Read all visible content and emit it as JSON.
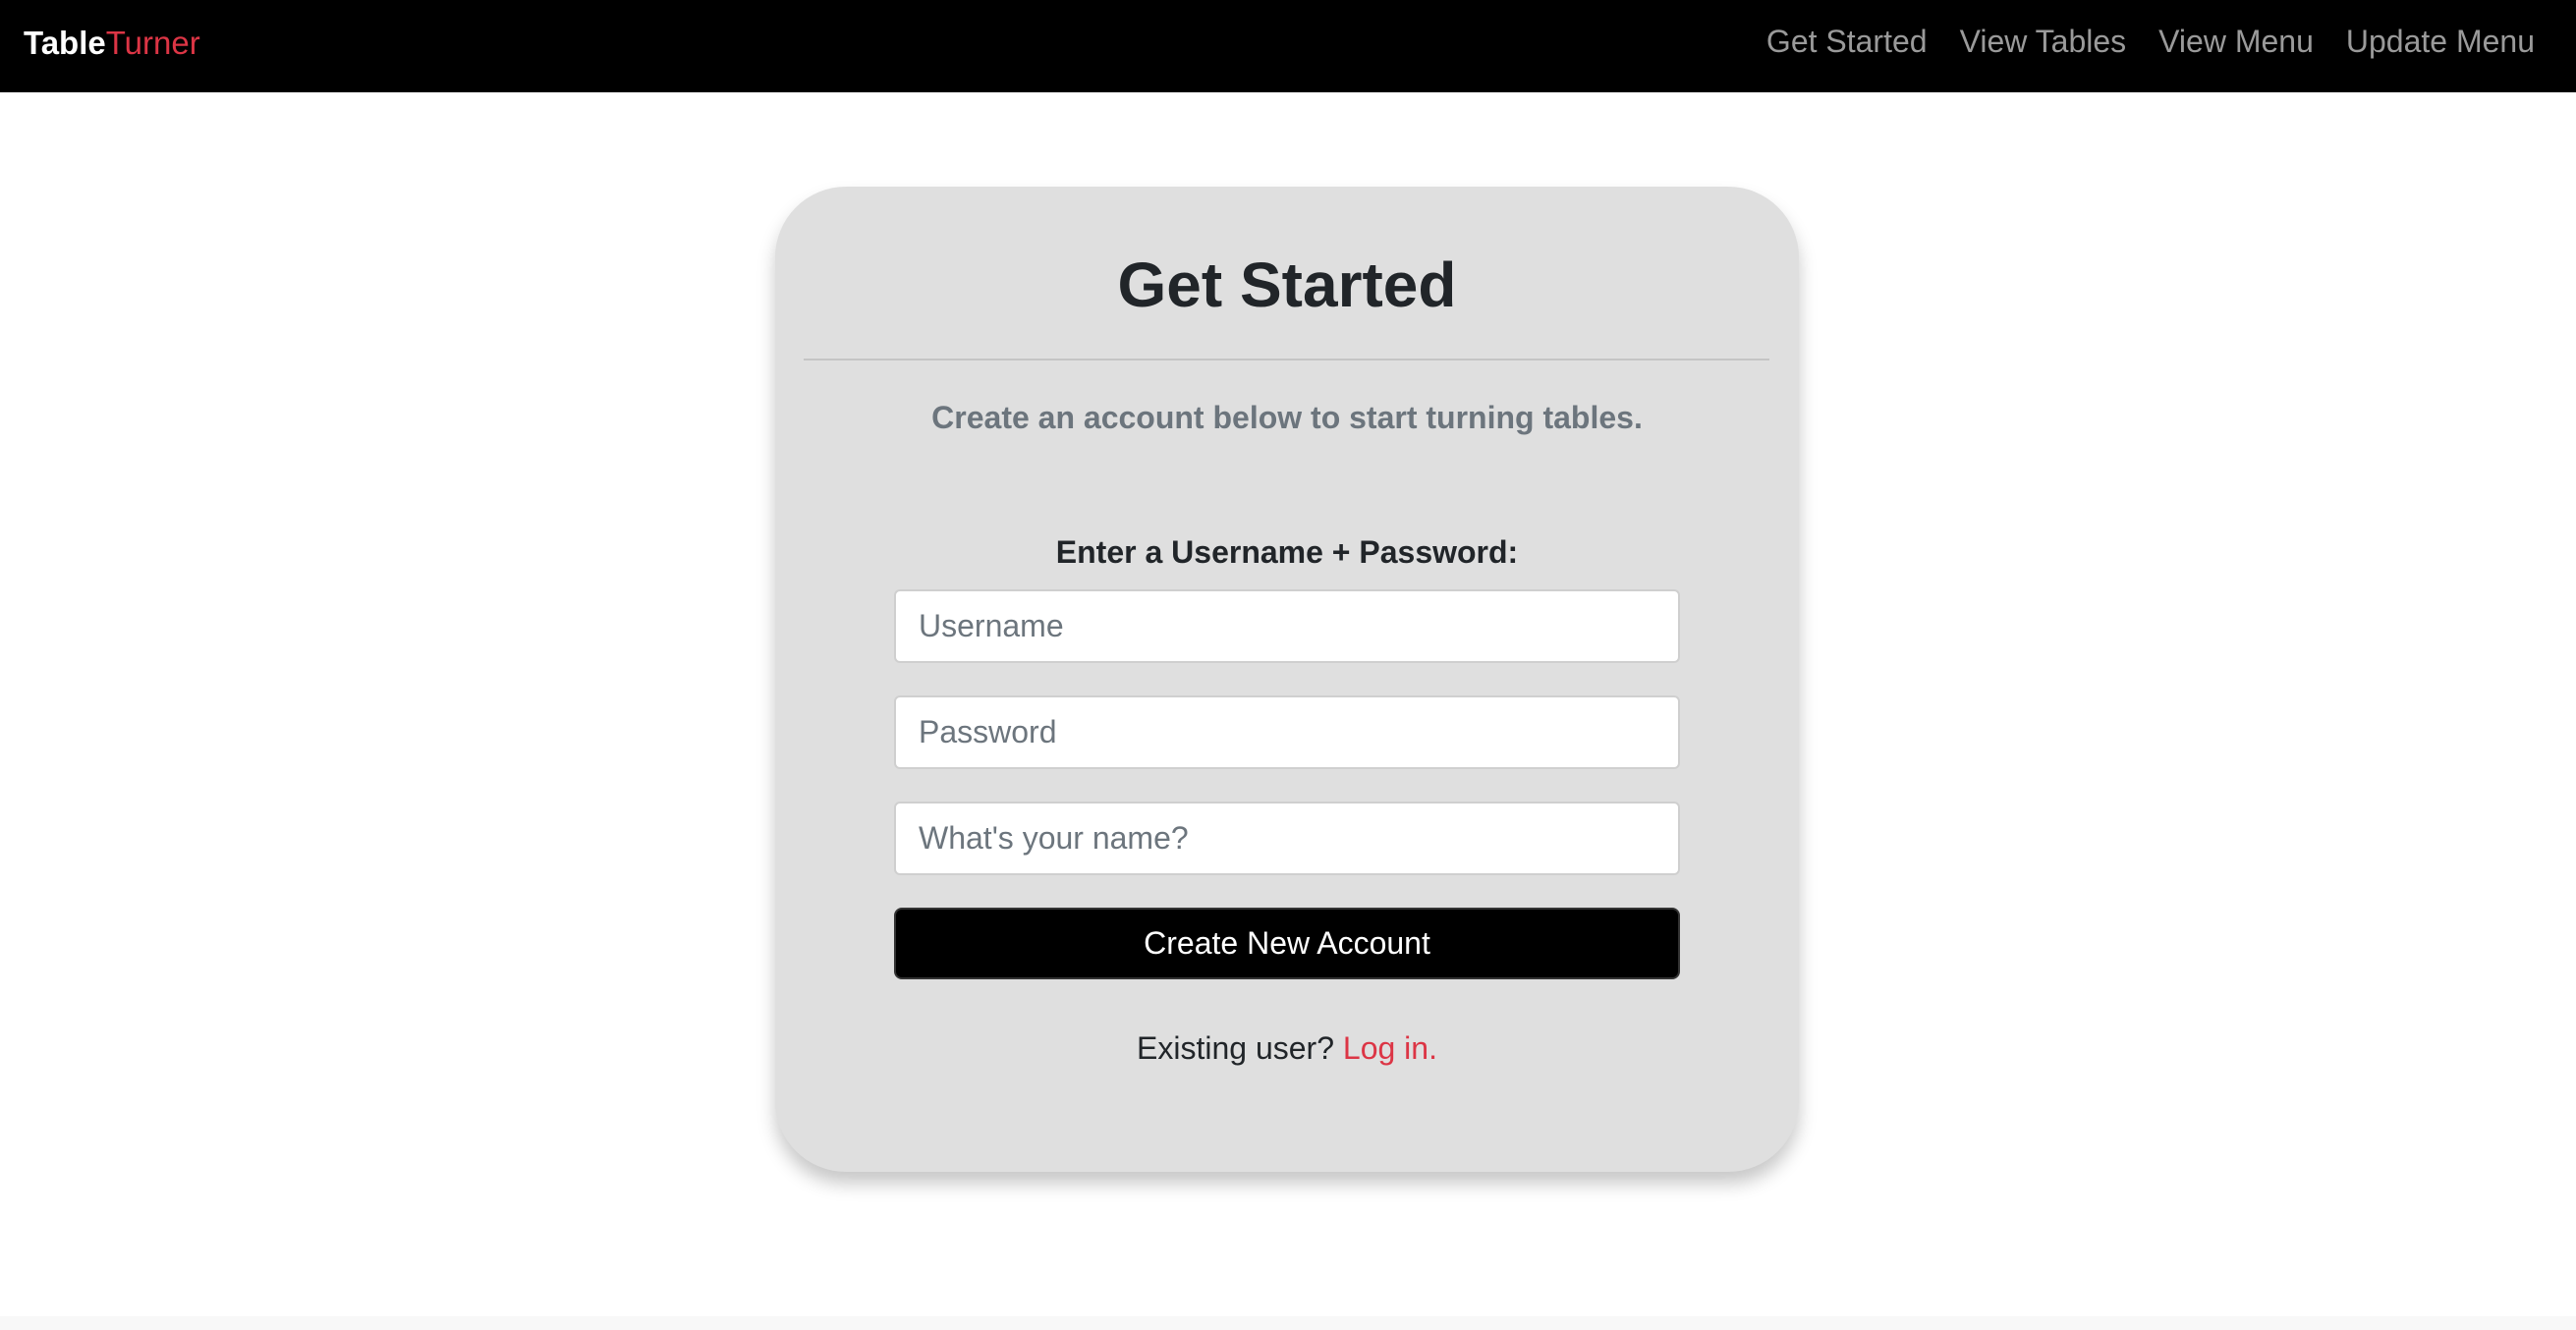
{
  "navbar": {
    "brand_part1": "Table",
    "brand_part2": "Turner",
    "links": [
      "Get Started",
      "View Tables",
      "View Menu",
      "Update Menu"
    ]
  },
  "card": {
    "title": "Get Started",
    "subtitle": "Create an account below to start turning tables.",
    "form_label": "Enter a Username + Password:",
    "username_placeholder": "Username",
    "password_placeholder": "Password",
    "name_placeholder": "What's your name?",
    "submit_label": "Create New Account",
    "existing_user_text": "Existing user?",
    "login_link": "Log in."
  },
  "colors": {
    "navbar_bg": "#000000",
    "brand_accent": "#dc3545",
    "card_bg": "#dfdfdf",
    "muted_text": "#6c757d"
  }
}
